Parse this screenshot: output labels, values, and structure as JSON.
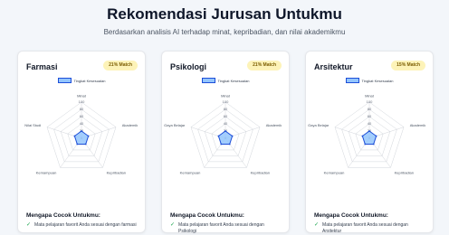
{
  "header": {
    "title": "Rekomendasi Jurusan Untukmu",
    "subtitle": "Berdasarkan analisis AI terhadap minat, kepribadian, dan nilai akademikmu"
  },
  "colors": {
    "accent": "#1d4ed8",
    "fill": "#93c5fd",
    "badge_bg": "#fdf3b8",
    "check": "#16a34a"
  },
  "cards": [
    {
      "title": "Farmasi",
      "match": "21% Match",
      "legend": "Tingkat Kesesuaian",
      "ticks": [
        "100",
        "80",
        "60",
        "40",
        "20",
        "0"
      ],
      "axes": [
        "Minat",
        "Akademik",
        "Kepribadian",
        "Kemampuan",
        "Nilai Studi"
      ],
      "chart_data": {
        "type": "radar",
        "series": [
          {
            "name": "Tingkat Kesesuaian",
            "values": [
              20,
              20,
              20,
              20,
              20
            ]
          }
        ],
        "range": [
          0,
          100
        ]
      },
      "why_title": "Mengapa Cocok Untukmu:",
      "why_item": "Mata pelajaran favorit Anda sesuai dengan farmasi"
    },
    {
      "title": "Psikologi",
      "match": "21% Match",
      "legend": "Tingkat Kesesuaian",
      "ticks": [
        "100",
        "80",
        "60",
        "40",
        "20",
        "0"
      ],
      "axes": [
        "Minat",
        "Akademik",
        "Kepribadian",
        "Kemampuan",
        "Gaya Belajar"
      ],
      "chart_data": {
        "type": "radar",
        "series": [
          {
            "name": "Tingkat Kesesuaian",
            "values": [
              20,
              20,
              20,
              20,
              20
            ]
          }
        ],
        "range": [
          0,
          100
        ]
      },
      "why_title": "Mengapa Cocok Untukmu:",
      "why_item": "Mata pelajaran favorit Anda sesuai dengan Psikologi"
    },
    {
      "title": "Arsitektur",
      "match": "15% Match",
      "legend": "Tingkat Kesesuaian",
      "ticks": [
        "100",
        "80",
        "60",
        "40",
        "20",
        "0"
      ],
      "axes": [
        "Minat",
        "Akademik",
        "Kepribadian",
        "Kemampuan",
        "Gaya Belajar"
      ],
      "chart_data": {
        "type": "radar",
        "series": [
          {
            "name": "Tingkat Kesesuaian",
            "values": [
              20,
              20,
              20,
              20,
              20
            ]
          }
        ],
        "range": [
          0,
          100
        ]
      },
      "why_title": "Mengapa Cocok Untukmu:",
      "why_item": "Mata pelajaran favorit Anda sesuai dengan Arsitektur"
    }
  ]
}
